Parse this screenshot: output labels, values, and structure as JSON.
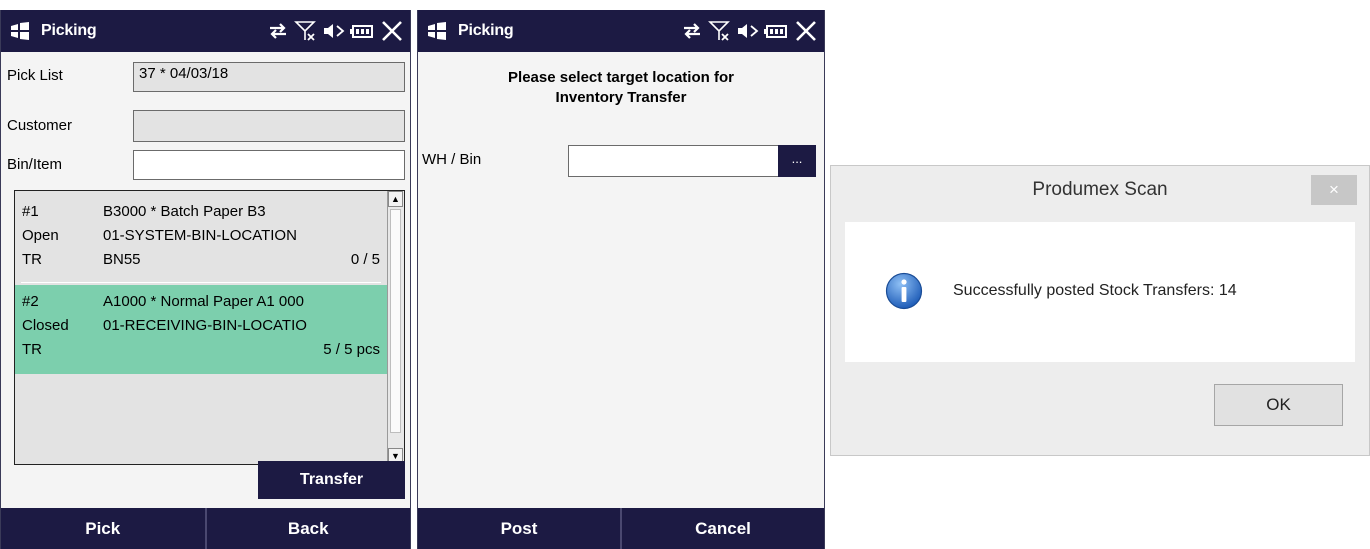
{
  "screen_left": {
    "title": "Picking",
    "fields": {
      "pick_list_label": "Pick List",
      "pick_list_value": "37 * 04/03/18",
      "customer_label": "Customer",
      "customer_value": "",
      "bin_item_label": "Bin/Item",
      "bin_item_value": ""
    },
    "rows": [
      {
        "num": "#1",
        "status": "Open",
        "type": "TR",
        "item": "B3000 * Batch Paper B3",
        "location": "01-SYSTEM-BIN-LOCATION",
        "batch": "BN55",
        "qty": "0 / 5",
        "selected": false
      },
      {
        "num": "#2",
        "status": "Closed",
        "type": "TR",
        "item": "A1000 * Normal Paper A1 000",
        "location": "01-RECEIVING-BIN-LOCATIO",
        "batch": "",
        "qty": "5 / 5 pcs",
        "selected": true
      }
    ],
    "transfer_label": "Transfer",
    "pick_label": "Pick",
    "back_label": "Back"
  },
  "screen_right": {
    "title": "Picking",
    "prompt_line1": "Please select target location for",
    "prompt_line2": "Inventory Transfer",
    "wh_bin_label": "WH / Bin",
    "wh_bin_value": "",
    "browse_label": "...",
    "post_label": "Post",
    "cancel_label": "Cancel"
  },
  "dialog": {
    "title": "Produmex Scan",
    "close_glyph": "×",
    "message": "Successfully posted Stock Transfers: 14",
    "ok_label": "OK"
  },
  "colors": {
    "titlebar": "#1c1a43",
    "selected_row": "#7ccfad",
    "info_icon": "#2f6fc4"
  },
  "icons": [
    "windows-logo-icon",
    "connectivity-icon",
    "no-signal-icon",
    "speaker-mute-icon",
    "battery-icon",
    "close-icon",
    "info-icon"
  ]
}
